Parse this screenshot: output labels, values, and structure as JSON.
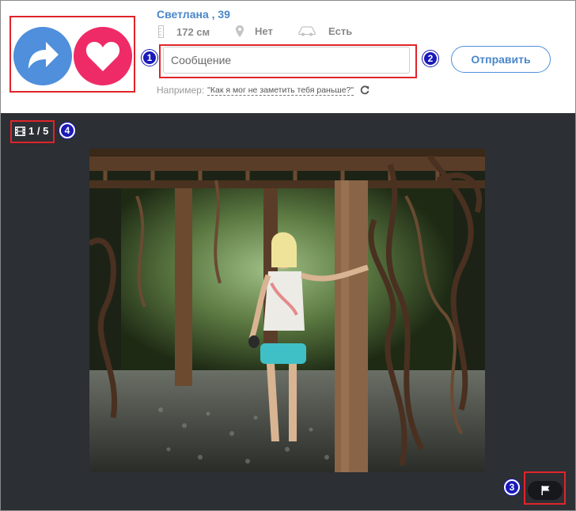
{
  "profile": {
    "name": "Светлана , 39",
    "height": "172 см",
    "kids": "Нет",
    "car": "Есть"
  },
  "message": {
    "placeholder": "Сообщение",
    "send_label": "Отправить",
    "example_prefix": "Например:",
    "example_text": "\"Как я мог не заметить тебя раньше?\""
  },
  "viewer": {
    "counter": "1 / 5"
  },
  "annotations": [
    "1",
    "2",
    "3",
    "4"
  ],
  "colors": {
    "accent": "#4a86c8",
    "share": "#4f8fdc",
    "like": "#ef2b67",
    "viewer_bg": "#2c2f34",
    "annotation_red": "#e0242a",
    "annotation_blue": "#1a1ab8"
  },
  "icons": [
    "share-arrow-icon",
    "heart-icon",
    "ruler-icon",
    "location-pin-icon",
    "car-icon",
    "refresh-icon",
    "film-icon",
    "flag-icon"
  ]
}
